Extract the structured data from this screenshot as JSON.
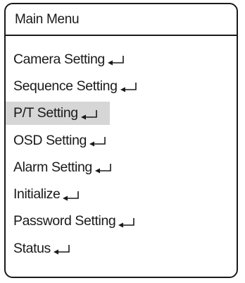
{
  "menu": {
    "title": "Main Menu",
    "items": [
      {
        "label": "Camera Setting",
        "icon": "enter-icon",
        "selected": false
      },
      {
        "label": "Sequence Setting",
        "icon": "enter-icon",
        "selected": false
      },
      {
        "label": "P/T Setting",
        "icon": "enter-icon",
        "selected": true
      },
      {
        "label": "OSD Setting",
        "icon": "enter-icon",
        "selected": false
      },
      {
        "label": "Alarm Setting",
        "icon": "enter-icon",
        "selected": false
      },
      {
        "label": "Initialize",
        "icon": "enter-icon",
        "selected": false
      },
      {
        "label": "Password Setting",
        "icon": "enter-icon",
        "selected": false
      },
      {
        "label": "Status",
        "icon": "enter-icon",
        "selected": false
      }
    ]
  },
  "colors": {
    "border": "#1a1a1a",
    "highlight": "#d6d6d6",
    "background": "#ffffff"
  }
}
